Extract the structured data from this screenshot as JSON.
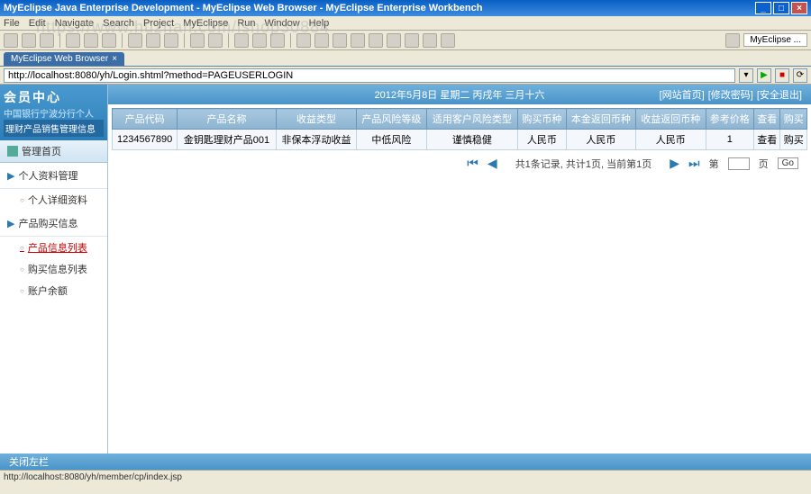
{
  "window": {
    "title": "MyEclipse Java Enterprise Development - MyEclipse Web Browser - MyEclipse Enterprise Workbench",
    "perspective_label": "MyEclipse ..."
  },
  "menus": [
    "File",
    "Edit",
    "Navigate",
    "Search",
    "Project",
    "MyEclipse",
    "Run",
    "Window",
    "Help"
  ],
  "watermark": "https://www.huzhan.com/ishop30884",
  "tab": {
    "label": "MyEclipse Web Browser"
  },
  "address": {
    "url": "http://localhost:8080/yh/Login.shtml?method=PAGEUSERLOGIN"
  },
  "sidebar": {
    "logo": "会员中心",
    "sub1": "中国银行宁波分行个人",
    "sub2": "理财产品销售管理信息",
    "home": "管理首页",
    "sections": [
      {
        "label": "个人资料管理",
        "items": [
          "个人详细资料"
        ]
      },
      {
        "label": "产品购买信息",
        "items": [
          "产品信息列表",
          "购买信息列表",
          "账户余额"
        ],
        "active_index": 0
      }
    ]
  },
  "topbar": {
    "date": "2012年5月8日 星期二 丙戌年 三月十六",
    "links": [
      "[网站首页]",
      "[修改密码]",
      "[安全退出]"
    ]
  },
  "table": {
    "headers": [
      "产品代码",
      "产品名称",
      "收益类型",
      "产品风险等级",
      "适用客户风险类型",
      "购买币种",
      "本金返回币种",
      "收益返回币种",
      "参考价格",
      "查看",
      "购买"
    ],
    "rows": [
      [
        "1234567890",
        "金钥匙理财产品001",
        "非保本浮动收益",
        "中低风险",
        "谨慎稳健",
        "人民币",
        "人民币",
        "人民币",
        "1",
        "查看",
        "购买"
      ]
    ]
  },
  "pager": {
    "summary": "共1条记录, 共计1页, 当前第1页",
    "page_label_prefix": "第",
    "page_label_suffix": "页",
    "go": "Go"
  },
  "bottom": {
    "label": "关闭左栏"
  },
  "status": {
    "text": "http://localhost:8080/yh/member/cp/index.jsp"
  }
}
